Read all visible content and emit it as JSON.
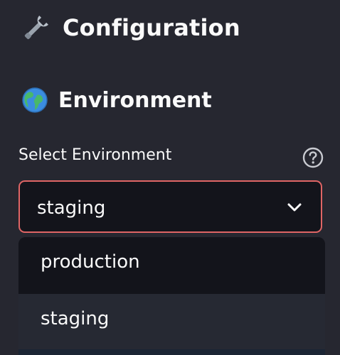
{
  "header": {
    "title": "Configuration",
    "icon": "wrench-icon"
  },
  "section": {
    "title": "Environment",
    "icon": "globe-icon"
  },
  "environment_select": {
    "label": "Select Environment",
    "selected": "staging",
    "help_icon": "question-circle-icon",
    "options": [
      "production",
      "staging"
    ],
    "highlighted_option": "staging"
  },
  "colors": {
    "background": "#262730",
    "input_background": "#13141b",
    "focus_border": "#e06565",
    "highlight_option": "#262933",
    "text": "#fafafa"
  }
}
